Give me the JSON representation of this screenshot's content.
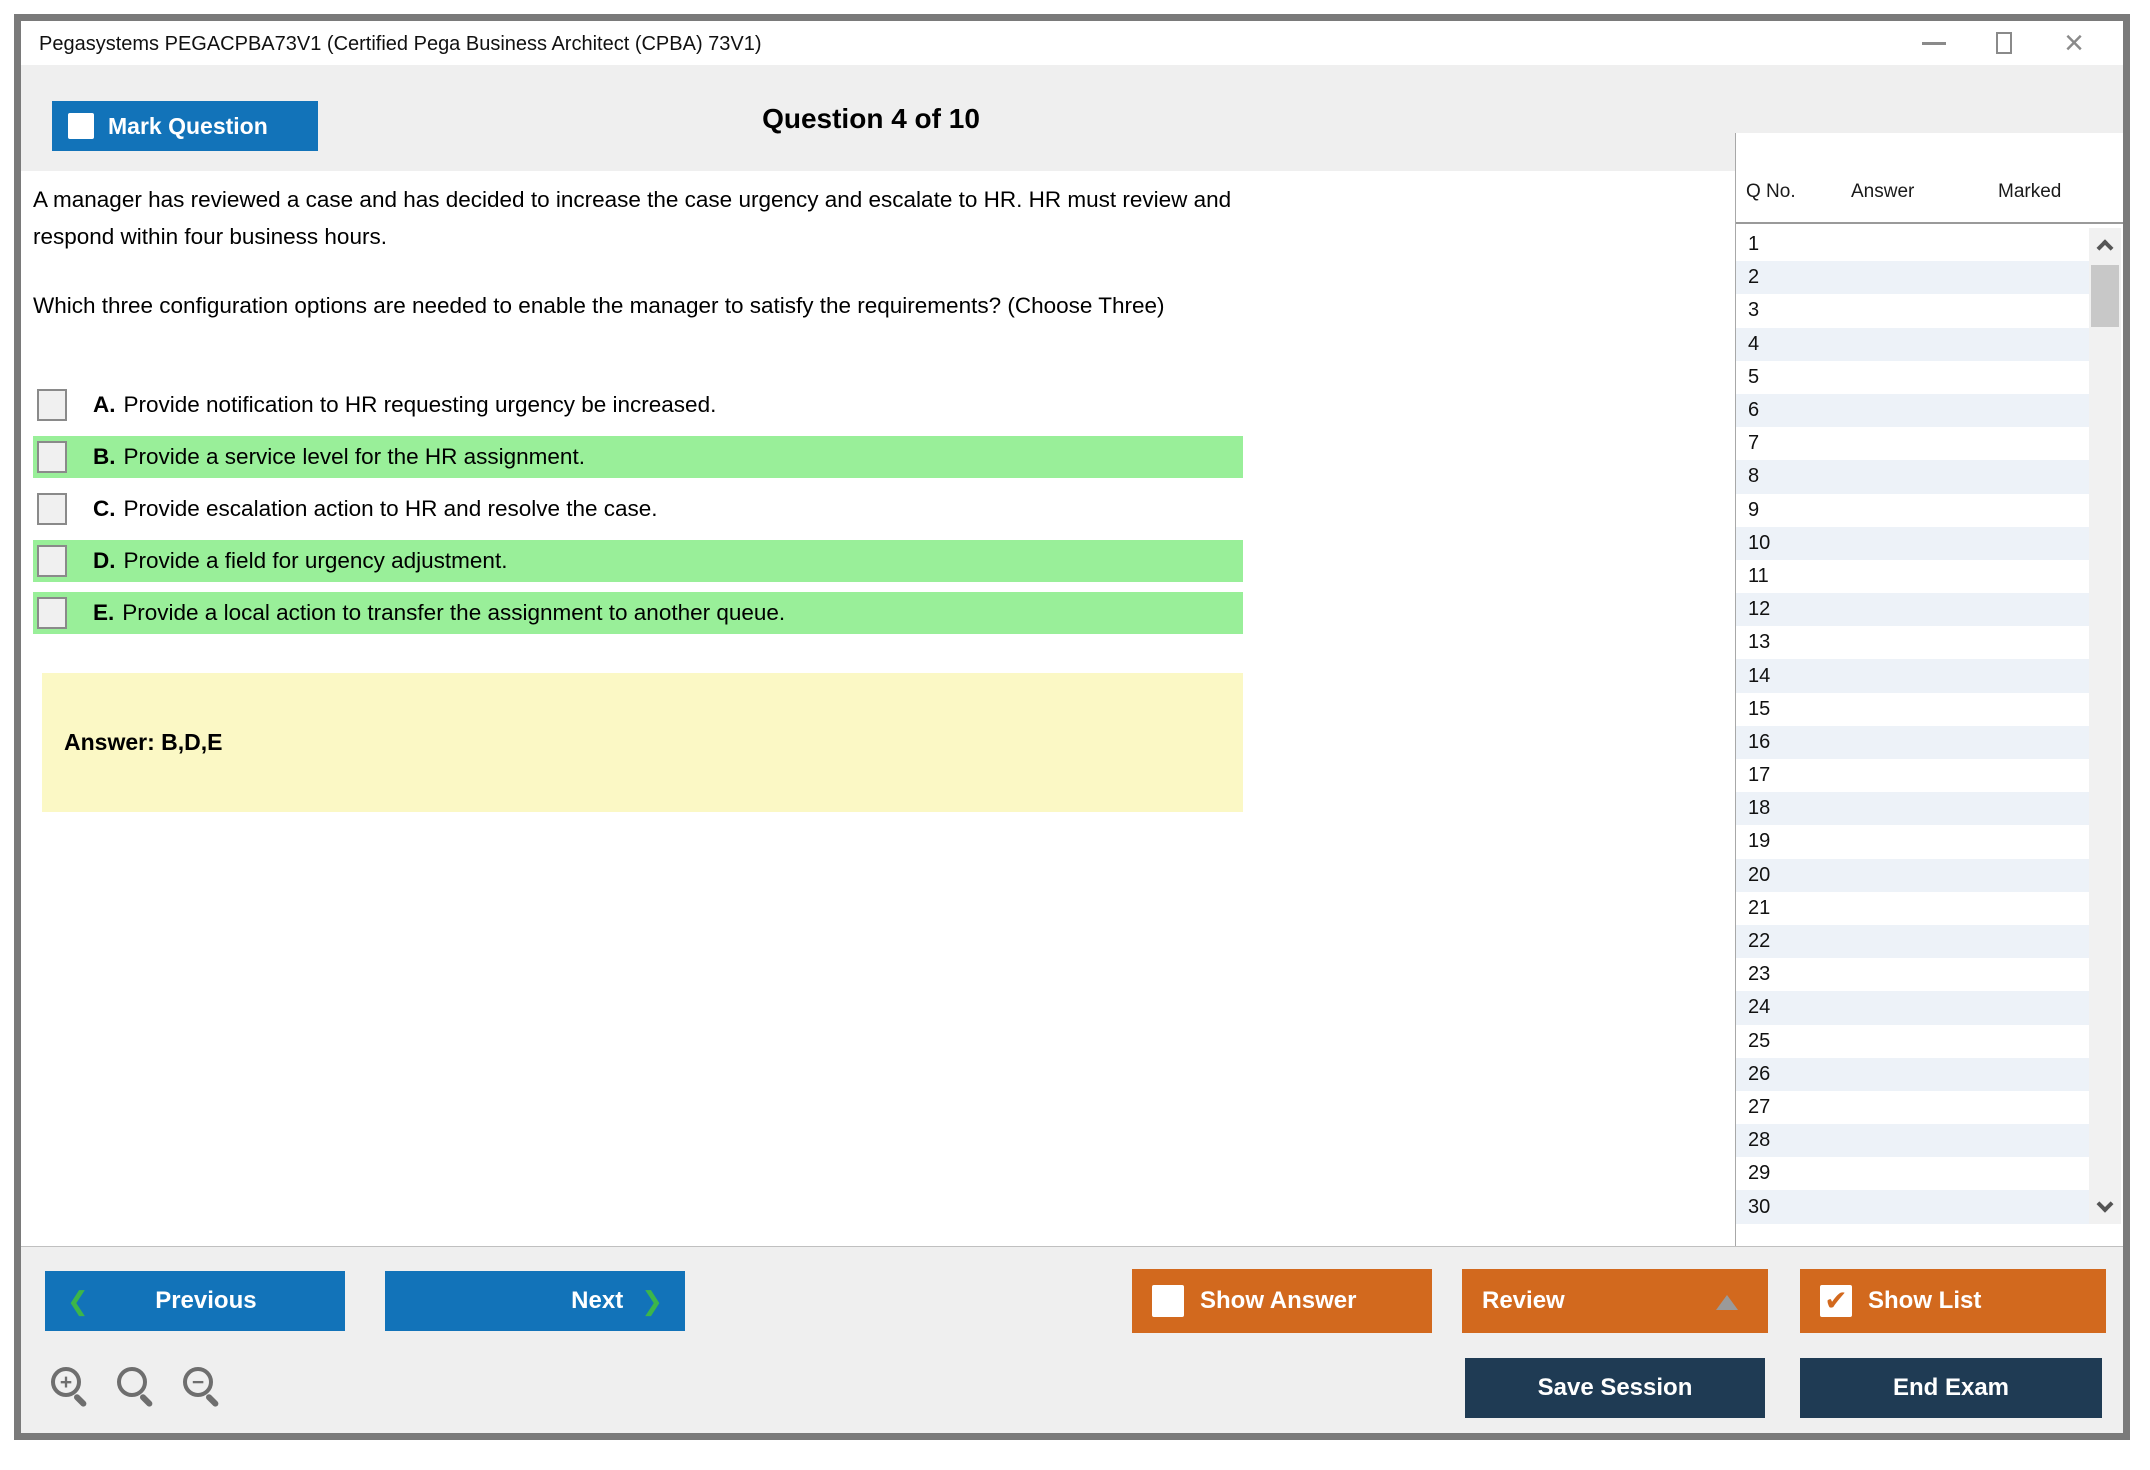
{
  "window": {
    "title": "Pegasystems PEGACPBA73V1 (Certified Pega Business Architect (CPBA) 73V1)"
  },
  "header": {
    "mark_question_label": "Mark Question",
    "question_counter": "Question 4 of 10"
  },
  "question": {
    "paragraph1": "A manager has reviewed a case and has decided to increase the case urgency and escalate to HR. HR must review and respond within four business hours.",
    "paragraph2": "Which three configuration options are needed to enable the manager to satisfy the requirements? (Choose Three)",
    "options": [
      {
        "letter": "A.",
        "text": "Provide notification to HR requesting urgency be increased.",
        "highlighted": false
      },
      {
        "letter": "B.",
        "text": "Provide a service level for the HR assignment.",
        "highlighted": true
      },
      {
        "letter": "C.",
        "text": "Provide escalation action to HR and resolve the case.",
        "highlighted": false
      },
      {
        "letter": "D.",
        "text": "Provide a field for urgency adjustment.",
        "highlighted": true
      },
      {
        "letter": "E.",
        "text": "Provide a local action to transfer the assignment to another queue.",
        "highlighted": true
      }
    ],
    "answer_label": "Answer: B,D,E"
  },
  "sidebar": {
    "columns": [
      "Q No.",
      "Answer",
      "Marked"
    ],
    "question_numbers": [
      "1",
      "2",
      "3",
      "4",
      "5",
      "6",
      "7",
      "8",
      "9",
      "10",
      "11",
      "12",
      "13",
      "14",
      "15",
      "16",
      "17",
      "18",
      "19",
      "20",
      "21",
      "22",
      "23",
      "24",
      "25",
      "26",
      "27",
      "28",
      "29",
      "30"
    ]
  },
  "footer": {
    "previous_label": "Previous",
    "next_label": "Next",
    "show_answer_label": "Show Answer",
    "review_label": "Review",
    "show_list_label": "Show List",
    "save_session_label": "Save Session",
    "end_exam_label": "End Exam",
    "show_list_checked": "✔"
  },
  "colors": {
    "accent_blue": "#1273b9",
    "accent_orange": "#d2691e",
    "navy": "#1f3b54",
    "highlight_green": "#99ef99",
    "answer_yellow": "#fbf8c5",
    "band_gray": "#efefef",
    "stripe_blue": "#edf2f8",
    "chevron_green": "#3cb64a"
  }
}
